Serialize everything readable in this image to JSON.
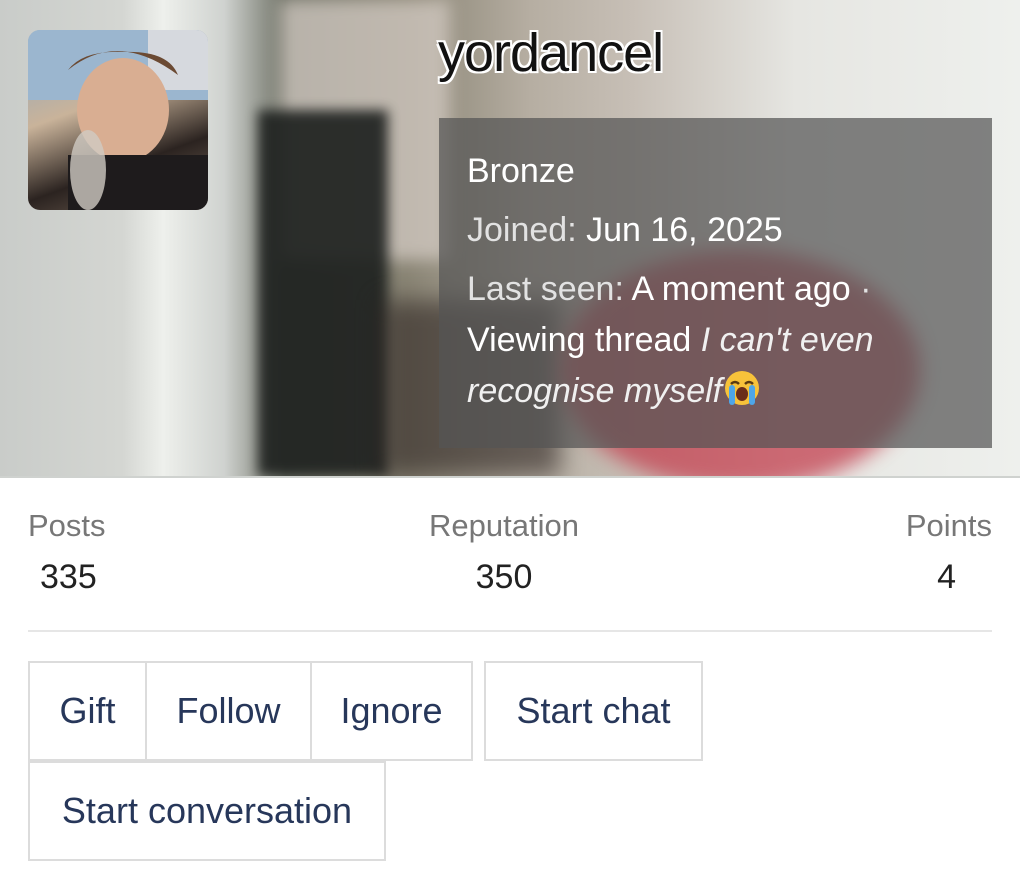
{
  "profile": {
    "username": "yordancel",
    "rank": "Bronze",
    "joined_label": "Joined:",
    "joined_value": "Jun 16, 2025",
    "lastseen_label": "Last seen:",
    "lastseen_value": "A moment ago",
    "separator": "·",
    "activity": "Viewing thread",
    "thread_title": "I can't even recognise myself",
    "emoji": "loudly-crying-face-icon"
  },
  "stats": {
    "posts_label": "Posts",
    "posts_value": "335",
    "reputation_label": "Reputation",
    "reputation_value": "350",
    "points_label": "Points",
    "points_value": "4"
  },
  "actions": {
    "gift": "Gift",
    "follow": "Follow",
    "ignore": "Ignore",
    "start_chat": "Start chat",
    "start_conversation": "Start conversation"
  },
  "colors": {
    "button_text": "#27375a",
    "info_overlay": "#555555"
  }
}
